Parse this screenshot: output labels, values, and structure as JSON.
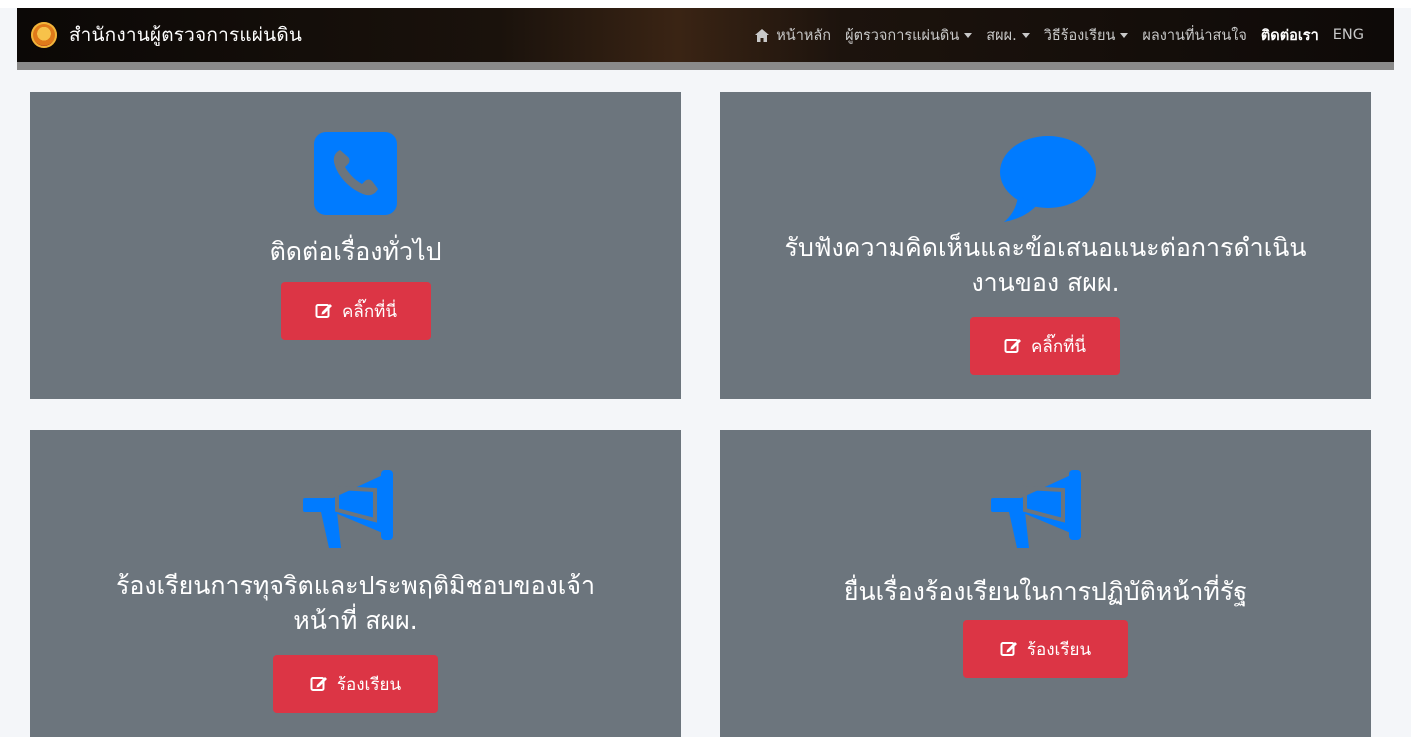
{
  "navbar": {
    "brand_title": "สำนักงานผู้ตรวจการแผ่นดิน",
    "items": [
      {
        "label": "หน้าหลัก",
        "has_icon": "home-icon"
      },
      {
        "label": "ผู้ตรวจการแผ่นดิน",
        "dropdown": true
      },
      {
        "label": "สผผ.",
        "dropdown": true
      },
      {
        "label": "วิธีร้องเรียน",
        "dropdown": true
      },
      {
        "label": "ผลงานที่น่าสนใจ"
      },
      {
        "label": "ติดต่อเรา",
        "active": true
      },
      {
        "label": "ENG"
      }
    ]
  },
  "cards": [
    {
      "icon": "phone-icon",
      "title": "ติดต่อเรื่องทั่วไป",
      "button": "คลิ๊กที่นี่"
    },
    {
      "icon": "speech-bubble-icon",
      "title_line1": "รับฟังความคิดเห็นและข้อเสนอแนะต่อการดำเนิน",
      "title_line2": "งานของ สผผ.",
      "button": "คลิ๊กที่นี่"
    },
    {
      "icon": "megaphone-icon",
      "title_line1": "ร้องเรียนการทุจริตและประพฤติมิชอบของเจ้า",
      "title_line2": "หน้าที่ สผผ.",
      "button": "ร้องเรียน"
    },
    {
      "icon": "megaphone-icon",
      "title": "ยื่นเรื่องร้องเรียนในการปฏิบัติหน้าที่รัฐ",
      "button": "ร้องเรียน"
    }
  ],
  "colors": {
    "card_bg": "#6c757d",
    "button": "#dc3545",
    "icon": "#007bff",
    "page_bg": "#f4f6f9"
  }
}
